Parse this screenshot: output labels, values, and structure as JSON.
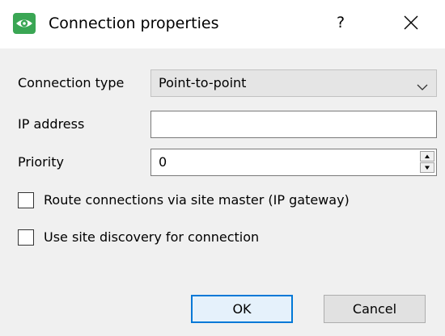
{
  "window": {
    "title": "Connection properties",
    "help_label": "?",
    "icons": {
      "app": "eye-icon",
      "close": "close-icon"
    },
    "colors": {
      "app_icon": "#3aa654",
      "ok_border": "#0078d7"
    }
  },
  "form": {
    "connection_type": {
      "label": "Connection type",
      "value": "Point-to-point"
    },
    "ip_address": {
      "label": "IP address",
      "value": ""
    },
    "priority": {
      "label": "Priority",
      "value": "0"
    }
  },
  "options": [
    {
      "label": "Route connections via site master (IP gateway)",
      "checked": false
    },
    {
      "label": "Use site discovery for connection",
      "checked": false
    }
  ],
  "buttons": {
    "ok": "OK",
    "cancel": "Cancel"
  }
}
